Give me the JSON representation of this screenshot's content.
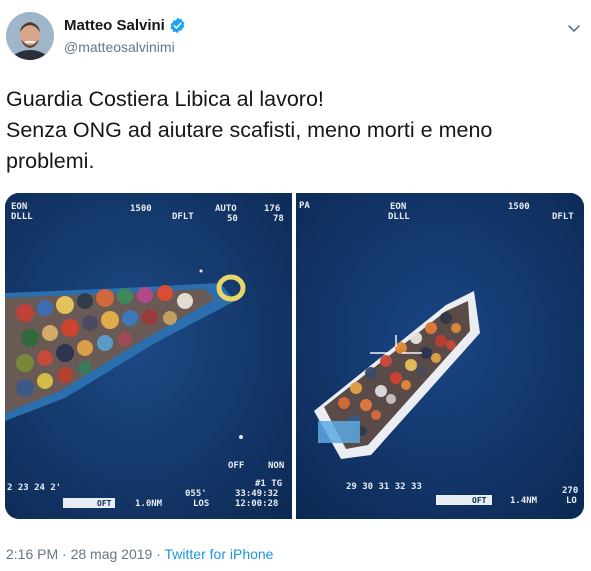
{
  "tweet": {
    "author_name": "Matteo Salvini",
    "author_handle": "@matteosalvinimi",
    "text_lines": [
      "Guardia Costiera Libica al lavoro!",
      "Senza ONG ad aiutare scafisti, meno morti e meno",
      "problemi."
    ],
    "time": "2:16 PM",
    "separator": " · ",
    "date": "28 mag 2019",
    "source": "Twitter for iPhone"
  },
  "icons": {
    "verified": "verified-badge-icon",
    "menu": "chevron-down-icon"
  },
  "colors": {
    "verified_blue": "#1da1f2",
    "link_blue": "#1b95e0",
    "secondary_text": "#657786",
    "sea": "#163a6b"
  },
  "photos": {
    "left_overlay": {
      "eon": "EON",
      "dll": "DLLL",
      "top_center": "1500",
      "dflt": "DFLT",
      "auto": "AUTO",
      "auto_val": "50",
      "corner_top": "176",
      "corner_bottom": "78",
      "off": "OFF",
      "non": "NON",
      "scale": "2  23  24  2'",
      "range": "1.0NM",
      "angle": "055'",
      "los": "LOS",
      "tg": "#1 TG",
      "coords1": "33:49:32",
      "coords2": "12:00:28",
      "oft": "OFT"
    },
    "right_overlay": {
      "pa": "PA",
      "eon": "EON",
      "dll": "DLLL",
      "top_center": "1500",
      "dflt": "DFLT",
      "scale": "29  30  31  32  33",
      "oft": "OFT",
      "range": "1.4NM",
      "corner_top": "270",
      "corner_bottom": "LO"
    }
  }
}
